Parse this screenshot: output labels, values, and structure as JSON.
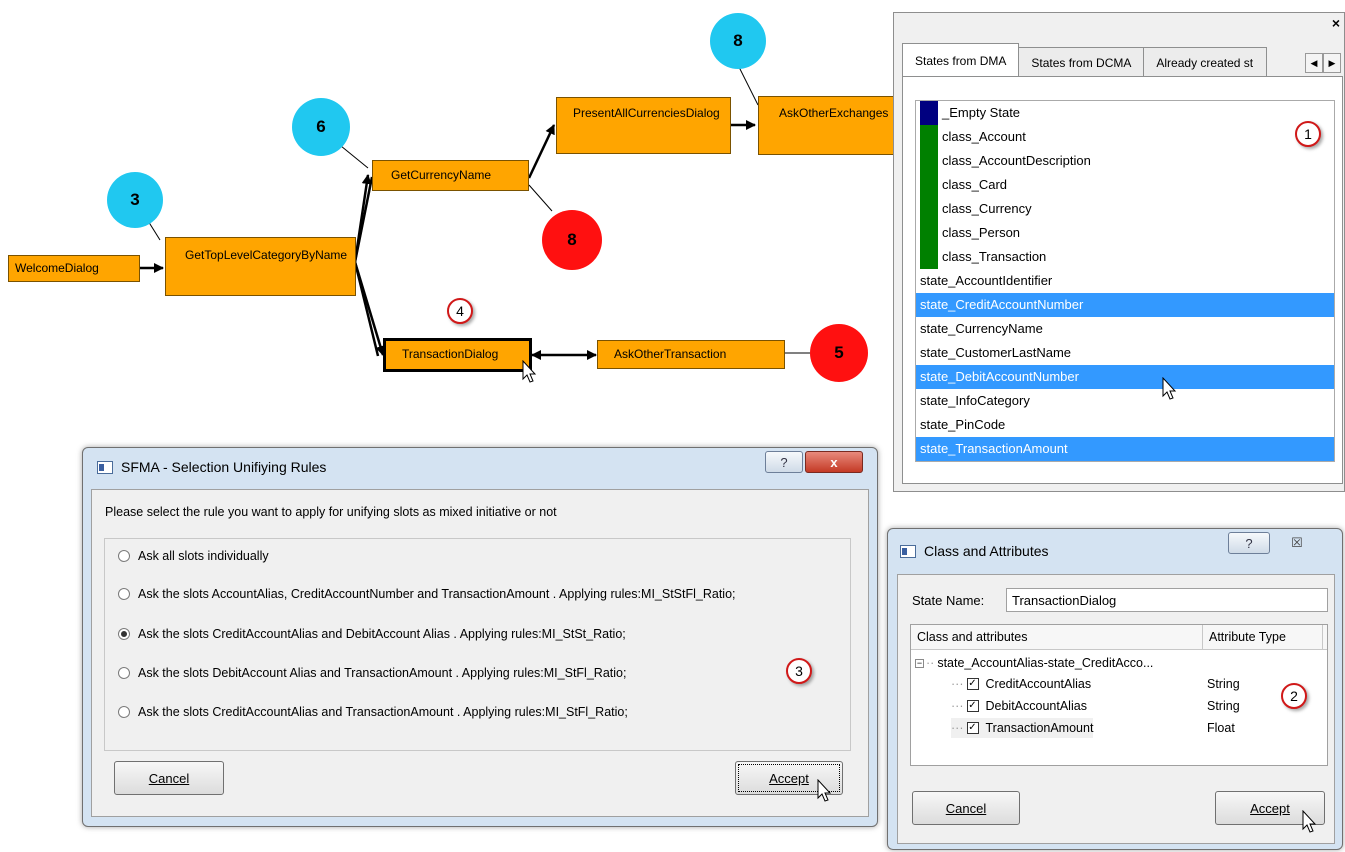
{
  "flow": {
    "nodes": {
      "welcome": "WelcomeDialog",
      "top_level": "GetTopLevelCategoryByName",
      "currency_name": "GetCurrencyName",
      "present_all": "PresentAllCurrenciesDialog",
      "ask_other_exchanges": "AskOtherExchanges",
      "transaction": "TransactionDialog",
      "ask_other_transaction": "AskOtherTransaction"
    },
    "bubbles": {
      "blue_3": "3",
      "blue_6": "6",
      "blue_8": "8",
      "red_8": "8",
      "red_5": "5"
    },
    "callout_4": "4"
  },
  "states_panel": {
    "close_glyph": "×",
    "tabs": [
      "States from DMA",
      "States from DCMA",
      "Already created st"
    ],
    "scroll_left": "◀",
    "scroll_right": "▶",
    "callout": "1",
    "items": [
      {
        "label": "_Empty State",
        "swatch": "#000080",
        "selected": false
      },
      {
        "label": "class_Account",
        "swatch": "#008000",
        "selected": false
      },
      {
        "label": "class_AccountDescription",
        "swatch": "#008000",
        "selected": false
      },
      {
        "label": "class_Card",
        "swatch": "#008000",
        "selected": false
      },
      {
        "label": "class_Currency",
        "swatch": "#008000",
        "selected": false
      },
      {
        "label": "class_Person",
        "swatch": "#008000",
        "selected": false
      },
      {
        "label": "class_Transaction",
        "swatch": "#008000",
        "selected": false
      },
      {
        "label": "state_AccountIdentifier",
        "selected": false
      },
      {
        "label": "state_CreditAccountNumber",
        "selected": true
      },
      {
        "label": "state_CurrencyName",
        "selected": false
      },
      {
        "label": "state_CustomerLastName",
        "selected": false
      },
      {
        "label": "state_DebitAccountNumber",
        "selected": true
      },
      {
        "label": "state_InfoCategory",
        "selected": false
      },
      {
        "label": "state_PinCode",
        "selected": false
      },
      {
        "label": "state_TransactionAmount",
        "selected": true
      }
    ]
  },
  "rules_dialog": {
    "title": "SFMA - Selection Unifiying Rules",
    "help_glyph": "?",
    "close_glyph": "x",
    "instruction": "Please select the rule you want to apply for unifying slots as mixed initiative or not",
    "options": [
      {
        "label": "Ask all slots individually",
        "checked": false
      },
      {
        "label": "Ask the slots AccountAlias, CreditAccountNumber  and TransactionAmount . Applying rules:MI_StStFl_Ratio;",
        "checked": false
      },
      {
        "label": "Ask the slots CreditAccountAlias  and DebitAccount Alias .  Applying  rules:MI_StSt_Ratio;",
        "checked": true
      },
      {
        "label": "Ask the slots DebitAccount Alias  and TransactionAmount . Applying rules:MI_StFl_Ratio;",
        "checked": false
      },
      {
        "label": "Ask the slots CreditAccountAlias  and TransactionAmount . Applying rules:MI_StFl_Ratio;",
        "checked": false
      }
    ],
    "callout": "3",
    "cancel_label": "Cancel",
    "accept_label": "Accept"
  },
  "class_dialog": {
    "title": "Class and Attributes",
    "help_glyph": "?",
    "close_glyph": "☒",
    "state_name_label": "State Name:",
    "state_name_value": "TransactionDialog",
    "columns": [
      "Class and attributes",
      "Attribute Type"
    ],
    "root_label": "state_AccountAlias-state_CreditAcco...",
    "expander_glyph": "−",
    "check_glyph": "✓",
    "attributes": [
      {
        "name": "CreditAccountAlias",
        "type": "String",
        "checked": true
      },
      {
        "name": "DebitAccountAlias",
        "type": "String",
        "checked": true
      },
      {
        "name": "TransactionAmount",
        "type": "Float",
        "checked": true
      }
    ],
    "callout": "2",
    "cancel_label": "Cancel",
    "accept_label": "Accept"
  }
}
